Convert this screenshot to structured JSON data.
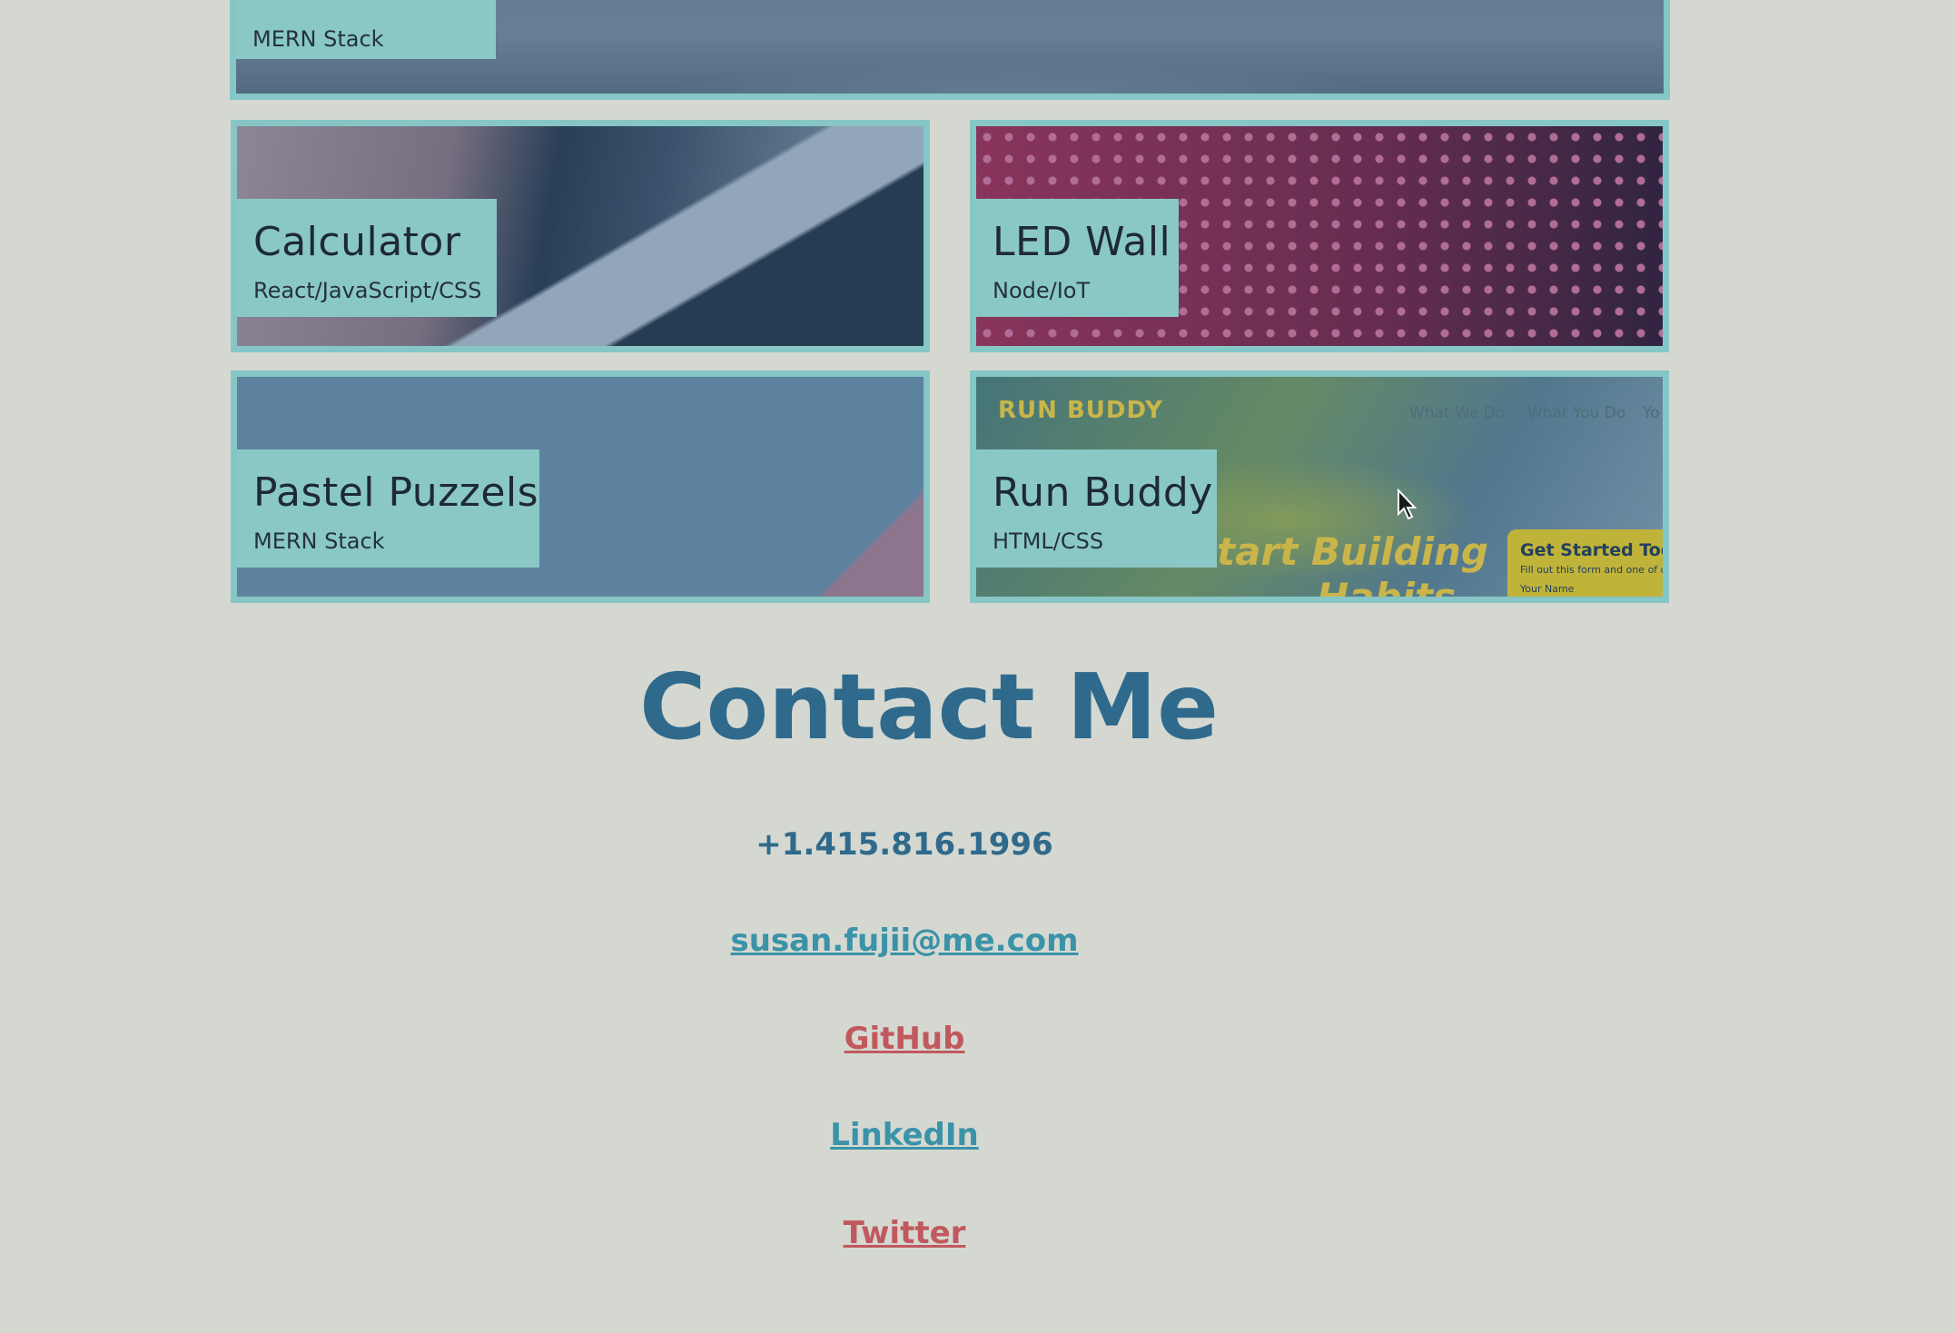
{
  "projects": {
    "top": {
      "subtitle": "MERN Stack"
    },
    "calculator": {
      "title": "Calculator",
      "subtitle": "React/JavaScript/CSS"
    },
    "led_wall": {
      "title": "LED Wall",
      "subtitle": "Node/IoT"
    },
    "pastel_puzzels": {
      "title": "Pastel Puzzels",
      "subtitle": "MERN Stack"
    },
    "run_buddy": {
      "title": "Run Buddy",
      "subtitle": "HTML/CSS",
      "preview": {
        "brand": "RUN BUDDY",
        "nav": [
          "What We Do",
          "What You Do",
          "Yo"
        ],
        "hero_line1": "tart Building",
        "hero_line2": "Habits",
        "form_title": "Get Started Today",
        "form_subtitle": "Fill out this form and one of o",
        "form_field": "Your Name"
      }
    }
  },
  "contact": {
    "title": "Contact Me",
    "phone": "+1.415.816.1996",
    "email": "susan.fujii@me.com",
    "github": "GitHub",
    "linkedin": "LinkedIn",
    "twitter": "Twitter"
  },
  "colors": {
    "background": "#d5d8d1",
    "card_border": "#86c6c6",
    "heading": "#2f6a8c",
    "link_teal": "#3a93a8",
    "link_red": "#c0595e"
  }
}
